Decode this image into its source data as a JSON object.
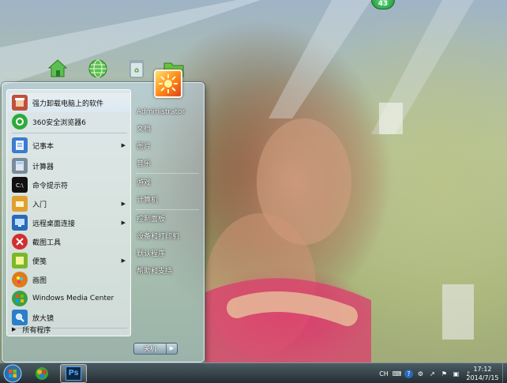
{
  "notification_badge": "43",
  "start_menu": {
    "programs": [
      {
        "label": "强力卸载电脑上的软件",
        "icon": "uninstall-icon",
        "color": "#c0503a"
      },
      {
        "label": "360安全浏览器6",
        "icon": "browser-360-icon",
        "color": "#2eaa3a"
      },
      {
        "label": "记事本",
        "icon": "notepad-icon",
        "color": "#3b7bd0",
        "arrow": "▶"
      },
      {
        "label": "计算器",
        "icon": "calculator-icon",
        "color": "#7a8a9a"
      },
      {
        "label": "命令提示符",
        "icon": "cmd-icon",
        "color": "#111111"
      },
      {
        "label": "入门",
        "icon": "getting-started-icon",
        "color": "#e0a030",
        "arrow": "▶"
      },
      {
        "label": "远程桌面连接",
        "icon": "remote-desktop-icon",
        "color": "#2a6ab8",
        "arrow": "▶"
      },
      {
        "label": "截图工具",
        "icon": "snipping-tool-icon",
        "color": "#d03030"
      },
      {
        "label": "便笺",
        "icon": "sticky-notes-icon",
        "color": "#7ab82a",
        "arrow": "▶"
      },
      {
        "label": "画图",
        "icon": "paint-icon",
        "color": "#e07a1a"
      },
      {
        "label": "Windows Media Center",
        "icon": "media-center-icon",
        "color": "#3aa04a"
      },
      {
        "label": "放大镜",
        "icon": "magnifier-icon",
        "color": "#2a80c8"
      }
    ],
    "all_programs": "所有程序",
    "all_programs_arrow": "▶",
    "right_items": [
      {
        "label": "Administrator",
        "name": "right-item-administrator"
      },
      {
        "label": "文档",
        "name": "right-item-documents"
      },
      {
        "label": "图片",
        "name": "right-item-pictures"
      },
      {
        "label": "音乐",
        "name": "right-item-music"
      },
      {
        "label": "游戏",
        "name": "right-item-games"
      },
      {
        "label": "计算机",
        "name": "right-item-computer"
      },
      {
        "label": "控制面板",
        "name": "right-item-control-panel"
      },
      {
        "label": "设备和打印机",
        "name": "right-item-devices-printers"
      },
      {
        "label": "默认程序",
        "name": "right-item-default-programs"
      },
      {
        "label": "帮助和支持",
        "name": "right-item-help-support"
      }
    ],
    "shutdown_label": "关机",
    "shutdown_arrow": "▶"
  },
  "taskbar": {
    "buttons": [
      {
        "icon": "start-orb-icon"
      },
      {
        "icon": "browser-360-icon"
      },
      {
        "icon": "photoshop-icon",
        "label": "Ps"
      }
    ],
    "clock_time": "17:12",
    "clock_date": "2014/7/15",
    "tray_ch": "CH"
  },
  "colors": {
    "taskbar": "#2a3a48",
    "accent_green": "#2eaa3a",
    "ps_blue": "#1b4fa0"
  }
}
